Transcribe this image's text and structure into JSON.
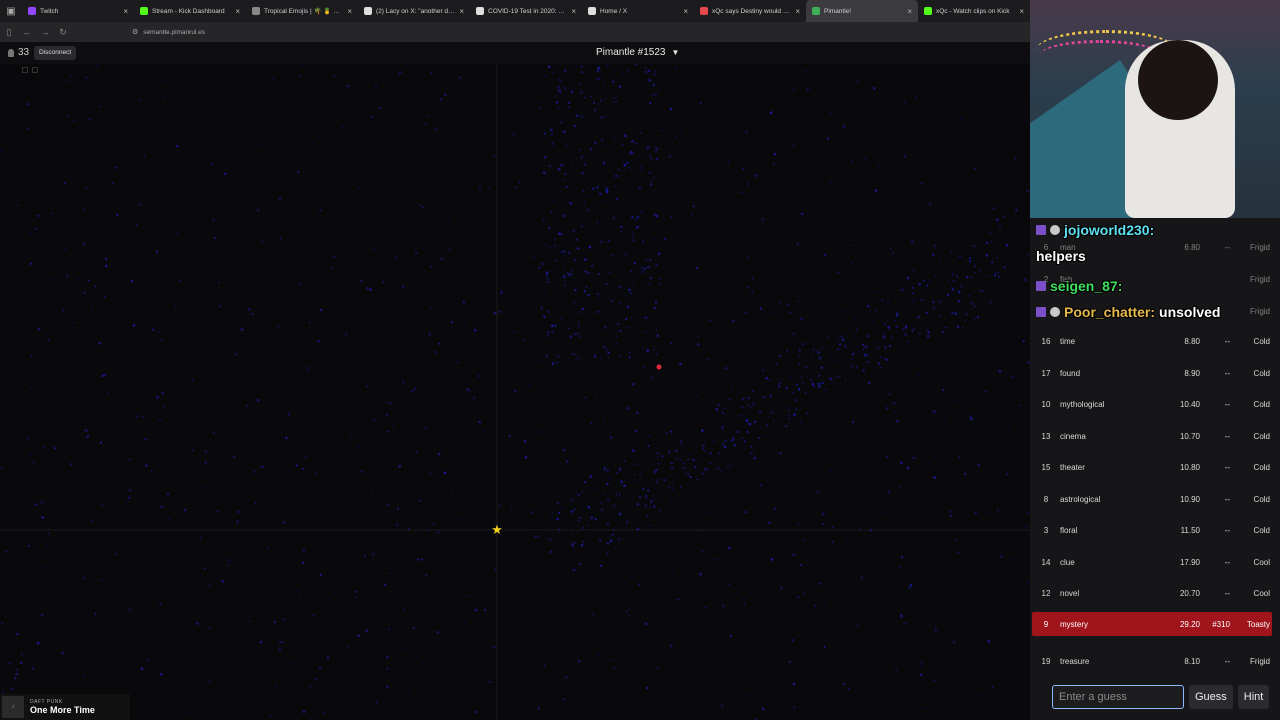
{
  "browser": {
    "tabs": [
      {
        "label": "Twitch",
        "color": "#9146ff",
        "active": false
      },
      {
        "label": "Stream - Kick Dashboard",
        "color": "#53fc18",
        "active": false
      },
      {
        "label": "Tropical Emojis | 🌴 🍍 🌺 🍇 🌸",
        "color": "#888888",
        "active": false
      },
      {
        "label": "(2) Lacy on X: \"another day, an...",
        "color": "#dddddd",
        "active": false
      },
      {
        "label": "COVID-19 Test in 2020: How It...",
        "color": "#dddddd",
        "active": false
      },
      {
        "label": "Home / X",
        "color": "#dddddd",
        "active": false
      },
      {
        "label": "xQc says Destiny would obliter...",
        "color": "#e5484d",
        "active": false
      },
      {
        "label": "Pimantle!",
        "color": "#3fae5a",
        "active": true
      },
      {
        "label": "xQc - Watch clips on Kick",
        "color": "#53fc18",
        "active": false
      }
    ],
    "url": "semantle.pimanrul.es"
  },
  "header": {
    "player_count": "33",
    "disconnect_label": "Disconnect",
    "game_title": "Pimantle #1523",
    "caret": "▼"
  },
  "guesses": [
    {
      "idx": "6",
      "word": "man",
      "score": "6.80",
      "rank": "--",
      "temp": "Frigid"
    },
    {
      "idx": "2",
      "word": "fish",
      "score": "",
      "rank": "",
      "temp": "Frigid"
    },
    {
      "idx": "",
      "word": "",
      "score": "",
      "rank": "",
      "temp": "Frigid"
    },
    {
      "idx": "16",
      "word": "time",
      "score": "8.80",
      "rank": "--",
      "temp": "Cold"
    },
    {
      "idx": "17",
      "word": "found",
      "score": "8.90",
      "rank": "--",
      "temp": "Cold"
    },
    {
      "idx": "10",
      "word": "mythological",
      "score": "10.40",
      "rank": "--",
      "temp": "Cold"
    },
    {
      "idx": "13",
      "word": "cinema",
      "score": "10.70",
      "rank": "--",
      "temp": "Cold"
    },
    {
      "idx": "15",
      "word": "theater",
      "score": "10.80",
      "rank": "--",
      "temp": "Cold"
    },
    {
      "idx": "8",
      "word": "astrological",
      "score": "10.90",
      "rank": "--",
      "temp": "Cold"
    },
    {
      "idx": "3",
      "word": "floral",
      "score": "11.50",
      "rank": "--",
      "temp": "Cold"
    },
    {
      "idx": "14",
      "word": "clue",
      "score": "17.90",
      "rank": "--",
      "temp": "Cool"
    },
    {
      "idx": "12",
      "word": "novel",
      "score": "20.70",
      "rank": "--",
      "temp": "Cool"
    },
    {
      "idx": "9",
      "word": "mystery",
      "score": "29.20",
      "rank": "#310",
      "temp": "Toasty"
    },
    {
      "idx": "19",
      "word": "treasure",
      "score": "8.10",
      "rank": "--",
      "temp": "Frigid"
    }
  ],
  "chat": [
    {
      "user": "jojoworld230:",
      "message": "helpers"
    },
    {
      "user": "seigen_87:",
      "message": ""
    },
    {
      "user": "Poor_chatter:",
      "message": "unsolved"
    }
  ],
  "input": {
    "placeholder": "Enter a guess",
    "guess_label": "Guess",
    "hint_label": "Hint"
  },
  "now_playing": {
    "artist": "DAFT PUNK",
    "song": "One More Time"
  },
  "colors": {
    "highlight": "#a0141c",
    "scatter": "#1c1ca8",
    "target": "#e0283a",
    "star": "#f2d21b"
  }
}
